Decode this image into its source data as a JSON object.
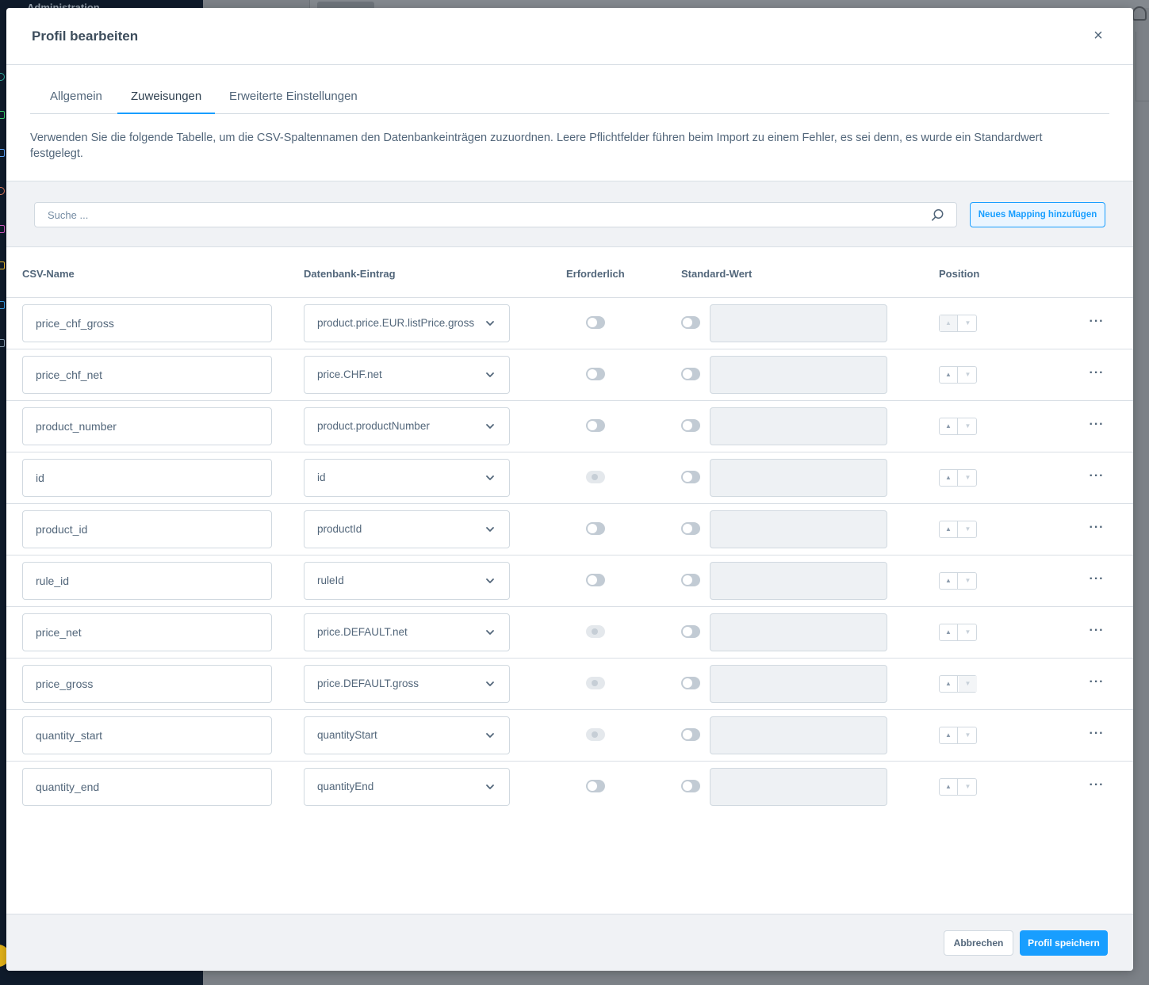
{
  "background": {
    "app_title": "Administration"
  },
  "modal": {
    "title": "Profil bearbeiten",
    "close_label": "×"
  },
  "tabs": [
    {
      "label": "Allgemein",
      "active": false
    },
    {
      "label": "Zuweisungen",
      "active": true
    },
    {
      "label": "Erweiterte Einstellungen",
      "active": false
    }
  ],
  "description": "Verwenden Sie die folgende Tabelle, um die CSV-Spaltennamen den Datenbankeinträgen zuzuordnen. Leere Pflichtfelder führen beim Import zu einem Fehler, es sei denn, es wurde ein Standardwert festgelegt.",
  "search": {
    "placeholder": "Suche ..."
  },
  "add_mapping_label": "Neues Mapping hinzufügen",
  "table": {
    "headers": {
      "csv_name": "CSV-Name",
      "db_entry": "Datenbank-Eintrag",
      "required": "Erforderlich",
      "default": "Standard-Wert",
      "position": "Position"
    },
    "rows": [
      {
        "csv": "price_chf_gross",
        "db": "product.price.EUR.listPrice.gross",
        "required_disabled": false,
        "up_disabled": true,
        "down_disabled": false
      },
      {
        "csv": "price_chf_net",
        "db": "price.CHF.net",
        "required_disabled": false,
        "up_disabled": false,
        "down_disabled": false
      },
      {
        "csv": "product_number",
        "db": "product.productNumber",
        "required_disabled": false,
        "up_disabled": false,
        "down_disabled": false
      },
      {
        "csv": "id",
        "db": "id",
        "required_disabled": true,
        "up_disabled": false,
        "down_disabled": false
      },
      {
        "csv": "product_id",
        "db": "productId",
        "required_disabled": false,
        "up_disabled": false,
        "down_disabled": false
      },
      {
        "csv": "rule_id",
        "db": "ruleId",
        "required_disabled": false,
        "up_disabled": false,
        "down_disabled": false
      },
      {
        "csv": "price_net",
        "db": "price.DEFAULT.net",
        "required_disabled": true,
        "up_disabled": false,
        "down_disabled": false
      },
      {
        "csv": "price_gross",
        "db": "price.DEFAULT.gross",
        "required_disabled": true,
        "up_disabled": false,
        "down_disabled": true
      },
      {
        "csv": "quantity_start",
        "db": "quantityStart",
        "required_disabled": true,
        "up_disabled": false,
        "down_disabled": false
      },
      {
        "csv": "quantity_end",
        "db": "quantityEnd",
        "required_disabled": false,
        "up_disabled": false,
        "down_disabled": false
      }
    ]
  },
  "footer": {
    "cancel_label": "Abbrechen",
    "save_label": "Profil speichern"
  },
  "colors": {
    "accent": "#189eff",
    "text": "#52667a",
    "border": "#d1d9e0"
  }
}
